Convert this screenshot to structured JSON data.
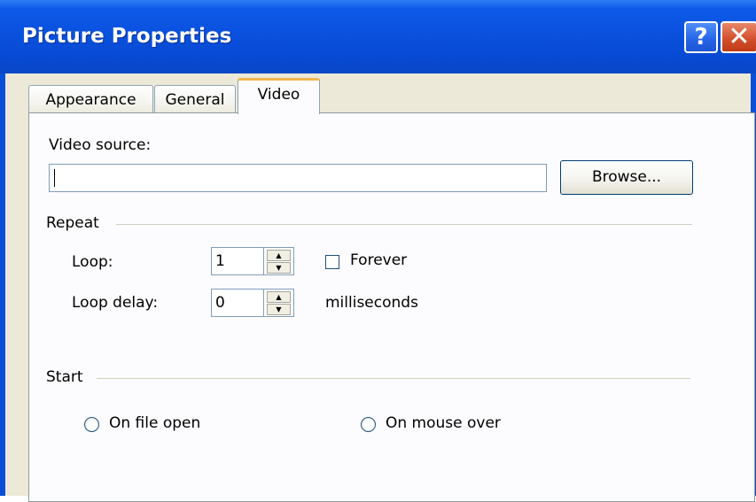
{
  "window": {
    "title": "Picture Properties",
    "help_button": "?",
    "close_button": "✕"
  },
  "tabs": [
    {
      "label": "Appearance",
      "selected": false
    },
    {
      "label": "General",
      "selected": false
    },
    {
      "label": "Video",
      "selected": true
    }
  ],
  "video": {
    "source_label": "Video source:",
    "source_value": "",
    "browse_label": "Browse..."
  },
  "repeat": {
    "group_label": "Repeat",
    "loop_label": "Loop:",
    "loop_value": "1",
    "loop_delay_label": "Loop delay:",
    "loop_delay_value": "0",
    "forever_label": "Forever",
    "forever_checked": false,
    "milliseconds_label": "milliseconds"
  },
  "start": {
    "group_label": "Start",
    "options": [
      {
        "label": "On file open",
        "selected": false
      },
      {
        "label": "On mouse over",
        "selected": false
      }
    ]
  },
  "colors": {
    "titlebar": "#0a51de",
    "dialog_bg": "#ece9d8",
    "panel_bg": "#fcfcfe",
    "selected_tab_accent": "#f3b64d",
    "close_button": "#d4502d"
  },
  "icons": {
    "spin_up": "▲",
    "spin_down": "▼"
  }
}
